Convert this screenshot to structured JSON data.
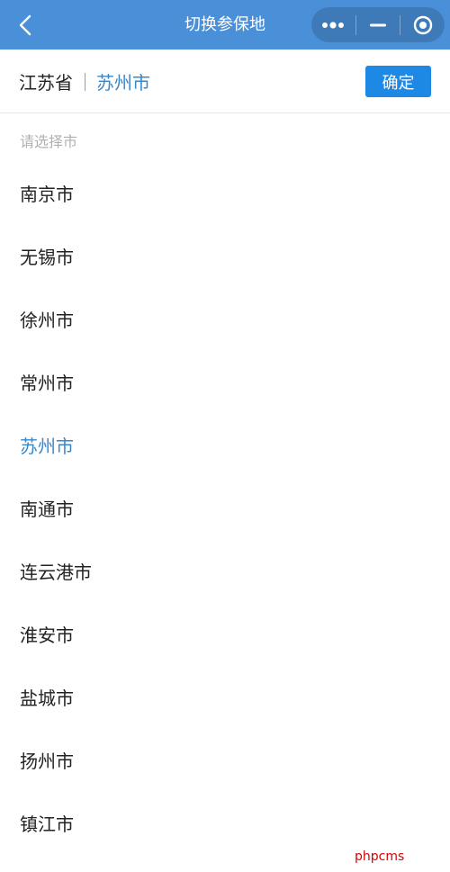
{
  "nav": {
    "title": "切换参保地",
    "bg_color": "#4a90d9",
    "icons": [
      "chevron-left-icon",
      "more-dots-icon",
      "minimize-icon",
      "close-target-icon"
    ]
  },
  "header": {
    "province": "江苏省",
    "city": "苏州市",
    "confirm_label": "确定",
    "accent_color": "#3a87c8",
    "button_color": "#1e88e5"
  },
  "hint": "请选择市",
  "cities": [
    {
      "name": "南京市",
      "selected": false
    },
    {
      "name": "无锡市",
      "selected": false
    },
    {
      "name": "徐州市",
      "selected": false
    },
    {
      "name": "常州市",
      "selected": false
    },
    {
      "name": "苏州市",
      "selected": true
    },
    {
      "name": "南通市",
      "selected": false
    },
    {
      "name": "连云港市",
      "selected": false
    },
    {
      "name": "淮安市",
      "selected": false
    },
    {
      "name": "盐城市",
      "selected": false
    },
    {
      "name": "扬州市",
      "selected": false
    },
    {
      "name": "镇江市",
      "selected": false
    }
  ],
  "watermark": "phpcms"
}
